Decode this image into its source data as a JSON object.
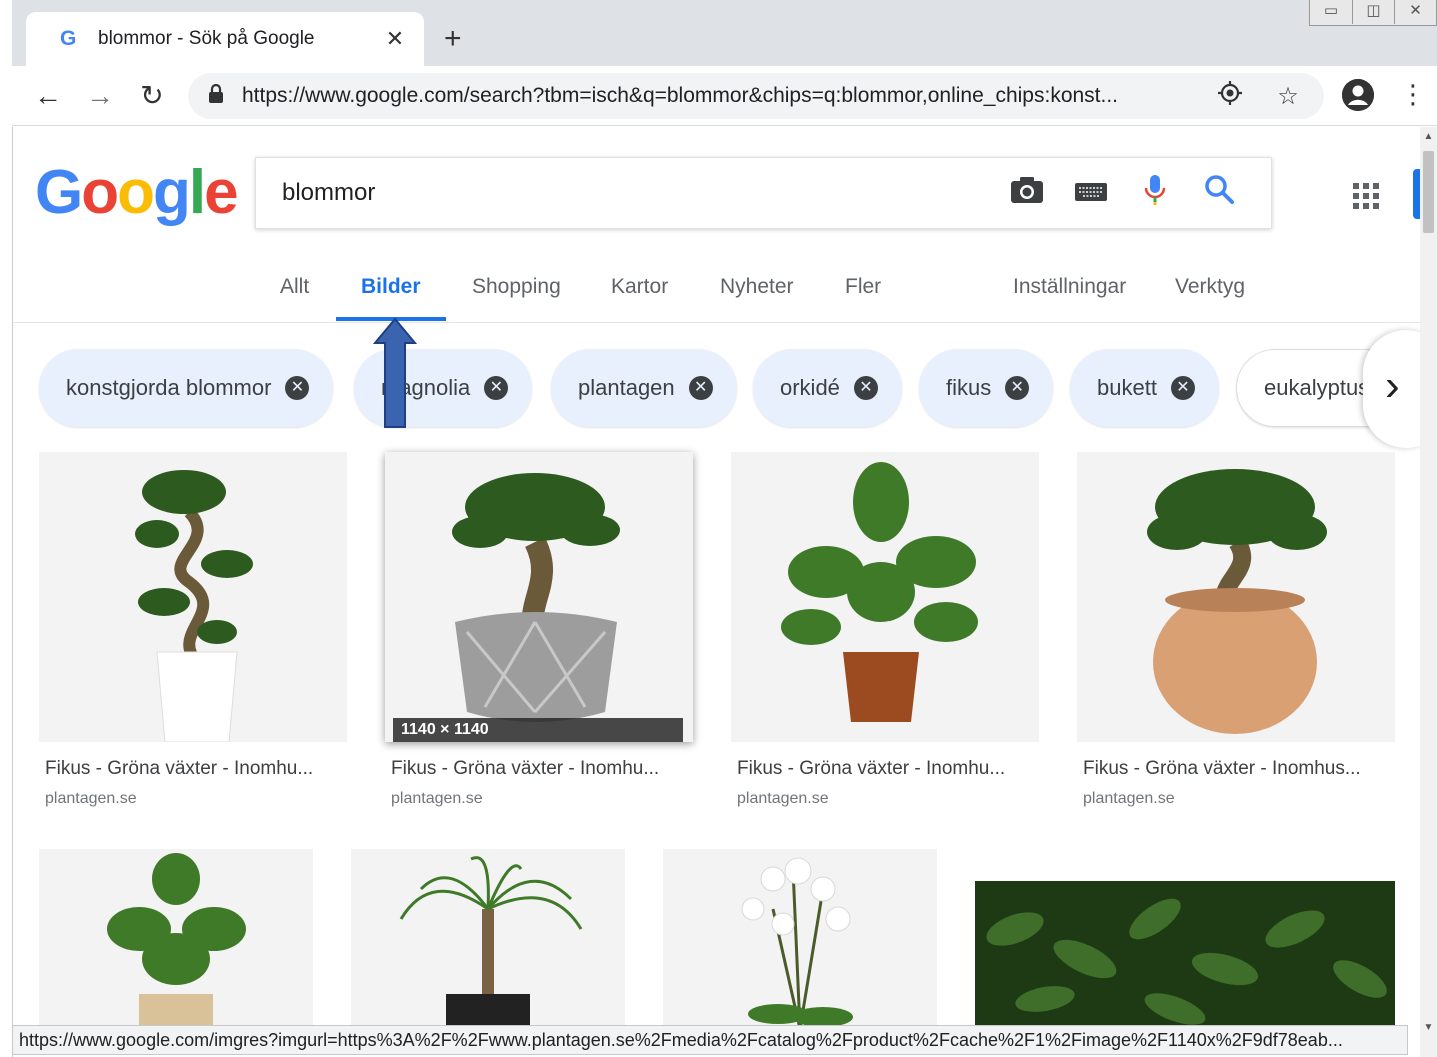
{
  "browser": {
    "tab_title": "blommor - Sök på Google",
    "tab_favicon": "G",
    "new_tab": "+",
    "url": "https://www.google.com/search?tbm=isch&q=blommor&chips=q:blommor,online_chips:konst...",
    "window_controls": [
      "▭",
      "◫",
      "✕"
    ]
  },
  "search": {
    "query": "blommor"
  },
  "tabs": [
    {
      "label": "Allt"
    },
    {
      "label": "Bilder"
    },
    {
      "label": "Shopping"
    },
    {
      "label": "Kartor"
    },
    {
      "label": "Nyheter"
    },
    {
      "label": "Fler"
    },
    {
      "label": "Inställningar"
    },
    {
      "label": "Verktyg"
    }
  ],
  "chips": [
    {
      "label": "konstgjorda blommor"
    },
    {
      "label": "magnolia"
    },
    {
      "label": "plantagen"
    },
    {
      "label": "orkidé"
    },
    {
      "label": "fikus"
    },
    {
      "label": "bukett"
    },
    {
      "label": "eukalyptus"
    }
  ],
  "results": [
    {
      "title": "Fikus - Gröna växter - Inomhu...",
      "source": "plantagen.se"
    },
    {
      "title": "Fikus - Gröna växter - Inomhu...",
      "source": "plantagen.se",
      "dims": "1140 × 1140"
    },
    {
      "title": "Fikus - Gröna växter - Inomhu...",
      "source": "plantagen.se"
    },
    {
      "title": "Fikus - Gröna växter - Inomhus...",
      "source": "plantagen.se"
    }
  ],
  "status_url": "https://www.google.com/imgres?imgurl=https%3A%2F%2Fwww.plantagen.se%2Fmedia%2Fcatalog%2Fproduct%2Fcache%2F1%2Fimage%2F1140x%2F9df78eab...",
  "colors": {
    "accent": "#1a73e8",
    "chip_bg": "#e8f0fe",
    "annotation_arrow": "#3a64b0"
  }
}
